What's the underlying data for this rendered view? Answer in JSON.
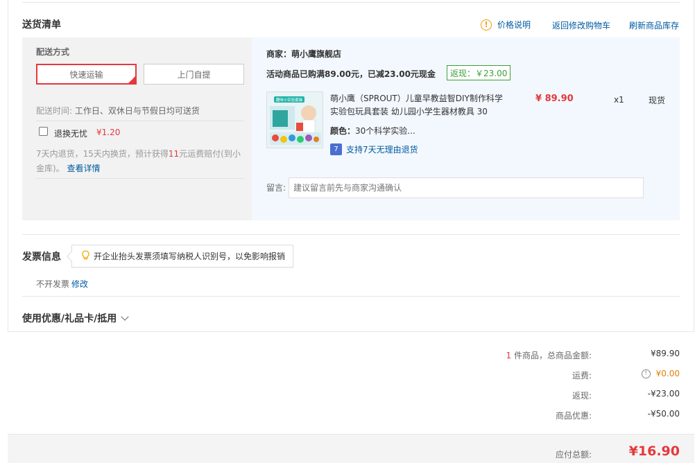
{
  "delivery": {
    "title": "送货清单",
    "price_info_icon": "!",
    "price_info": "价格说明",
    "back_to_cart": "返回修改购物车",
    "refresh_stock": "刷新商品库存",
    "shipping_method_label": "配送方式",
    "express_label": "快速运输",
    "pickup_label": "上门自提",
    "delivery_time_label": "配送时间:",
    "delivery_time_value": "工作日、双休日与节假日均可送货",
    "return_worry_label": "退换无忧",
    "return_worry_price": "¥1.20",
    "return_note_a": "7天内退货，15天内换货，预计获得",
    "return_note_num": "11",
    "return_note_b": "元运费赔付(到小金库)。",
    "view_details": "查看详情"
  },
  "shop": {
    "merchant_label": "商家：萌小鹰旗舰店",
    "promo_text": "活动商品已购满89.00元，已减23.00元现金",
    "rebate_badge": "返现：￥23.00",
    "product": {
      "name": "萌小鹰（SPROUT）儿童早教益智DIY制作科学实验包玩具套装 幼儿园小学生器材教具 30",
      "price": "¥ 89.90",
      "qty": "x1",
      "stock": "现货",
      "color_label": "颜色：",
      "color_value": "30个科学实验...",
      "seven_day_icon": "7",
      "seven_day": "支持7天无理由退货",
      "thumb_caption": "趣味小实验套装"
    },
    "message_label": "留言:",
    "message_placeholder": "建议留言前先与商家沟通确认"
  },
  "invoice": {
    "title": "发票信息",
    "tip": "开企业抬头发票须填写纳税人识别号，以免影响报销",
    "none_text": "不开发票",
    "modify": "修改"
  },
  "coupon": {
    "title": "使用优惠/礼品卡/抵用"
  },
  "summary": {
    "count": "1",
    "count_label": "件商品，总商品金额:",
    "goods_total": "¥89.90",
    "shipping_label": "运费:",
    "shipping_value": "¥0.00",
    "rebate_label": "返现:",
    "rebate_value": "-¥23.00",
    "discount_label": "商品优惠:",
    "discount_value": "-¥50.00",
    "payable_label": "应付总额:",
    "payable_value": "¥16.90"
  },
  "colors": {
    "accent_red": "#e4393c",
    "link_blue": "#005aa0",
    "warn_orange": "#f39800",
    "rebate_green": "#3b9f3b"
  }
}
